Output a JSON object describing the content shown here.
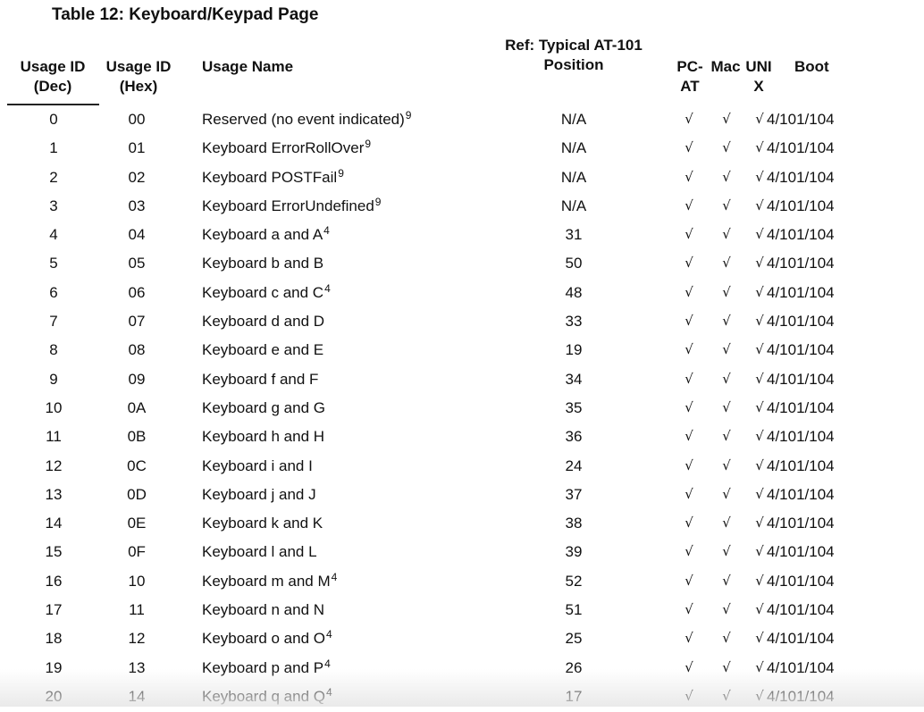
{
  "title": "Table 12: Keyboard/Keypad Page",
  "headers": {
    "dec_line1": "Usage ID",
    "dec_line2": "(Dec)",
    "hex_line1": "Usage ID",
    "hex_line2": "(Hex)",
    "name": "Usage Name",
    "pos_line1": "Ref: Typical AT-101",
    "pos_line2": "Position",
    "pc_line1": "PC-",
    "pc_line2": "AT",
    "mac": "Mac",
    "unix_line1": "UNI",
    "unix_line2": "X",
    "boot": "Boot"
  },
  "check": "√",
  "rows": [
    {
      "dec": "0",
      "hex": "00",
      "name": "Reserved (no event indicated)",
      "note": "9",
      "pos": "N/A",
      "boot": "4/101/104"
    },
    {
      "dec": "1",
      "hex": "01",
      "name": "Keyboard ErrorRollOver",
      "note": "9",
      "pos": "N/A",
      "boot": "4/101/104"
    },
    {
      "dec": "2",
      "hex": "02",
      "name": "Keyboard POSTFail",
      "note": "9",
      "pos": "N/A",
      "boot": "4/101/104"
    },
    {
      "dec": "3",
      "hex": "03",
      "name": "Keyboard ErrorUndefined",
      "note": "9",
      "pos": "N/A",
      "boot": "4/101/104"
    },
    {
      "dec": "4",
      "hex": "04",
      "name": "Keyboard a and A",
      "note": "4",
      "pos": "31",
      "boot": "4/101/104"
    },
    {
      "dec": "5",
      "hex": "05",
      "name": "Keyboard b and B",
      "note": "",
      "pos": "50",
      "boot": "4/101/104"
    },
    {
      "dec": "6",
      "hex": "06",
      "name": "Keyboard c and C",
      "note": "4",
      "pos": "48",
      "boot": "4/101/104"
    },
    {
      "dec": "7",
      "hex": "07",
      "name": "Keyboard d and D",
      "note": "",
      "pos": "33",
      "boot": "4/101/104"
    },
    {
      "dec": "8",
      "hex": "08",
      "name": "Keyboard e and E",
      "note": "",
      "pos": "19",
      "boot": "4/101/104"
    },
    {
      "dec": "9",
      "hex": "09",
      "name": "Keyboard f and F",
      "note": "",
      "pos": "34",
      "boot": "4/101/104"
    },
    {
      "dec": "10",
      "hex": "0A",
      "name": "Keyboard g and G",
      "note": "",
      "pos": "35",
      "boot": "4/101/104"
    },
    {
      "dec": "11",
      "hex": "0B",
      "name": "Keyboard h and H",
      "note": "",
      "pos": "36",
      "boot": "4/101/104"
    },
    {
      "dec": "12",
      "hex": "0C",
      "name": "Keyboard i and I",
      "note": "",
      "pos": "24",
      "boot": "4/101/104"
    },
    {
      "dec": "13",
      "hex": "0D",
      "name": "Keyboard j and J",
      "note": "",
      "pos": "37",
      "boot": "4/101/104"
    },
    {
      "dec": "14",
      "hex": "0E",
      "name": "Keyboard k and K",
      "note": "",
      "pos": "38",
      "boot": "4/101/104"
    },
    {
      "dec": "15",
      "hex": "0F",
      "name": "Keyboard l and L",
      "note": "",
      "pos": "39",
      "boot": "4/101/104"
    },
    {
      "dec": "16",
      "hex": "10",
      "name": "Keyboard m and M",
      "note": "4",
      "pos": "52",
      "boot": "4/101/104"
    },
    {
      "dec": "17",
      "hex": "11",
      "name": "Keyboard n and N",
      "note": "",
      "pos": "51",
      "boot": "4/101/104"
    },
    {
      "dec": "18",
      "hex": "12",
      "name": "Keyboard o and O",
      "note": "4",
      "pos": "25",
      "boot": "4/101/104"
    },
    {
      "dec": "19",
      "hex": "13",
      "name": "Keyboard p and P",
      "note": "4",
      "pos": "26",
      "boot": "4/101/104"
    },
    {
      "dec": "20",
      "hex": "14",
      "name": "Keyboard q and Q",
      "note": "4",
      "pos": "17",
      "boot": "4/101/104"
    }
  ]
}
